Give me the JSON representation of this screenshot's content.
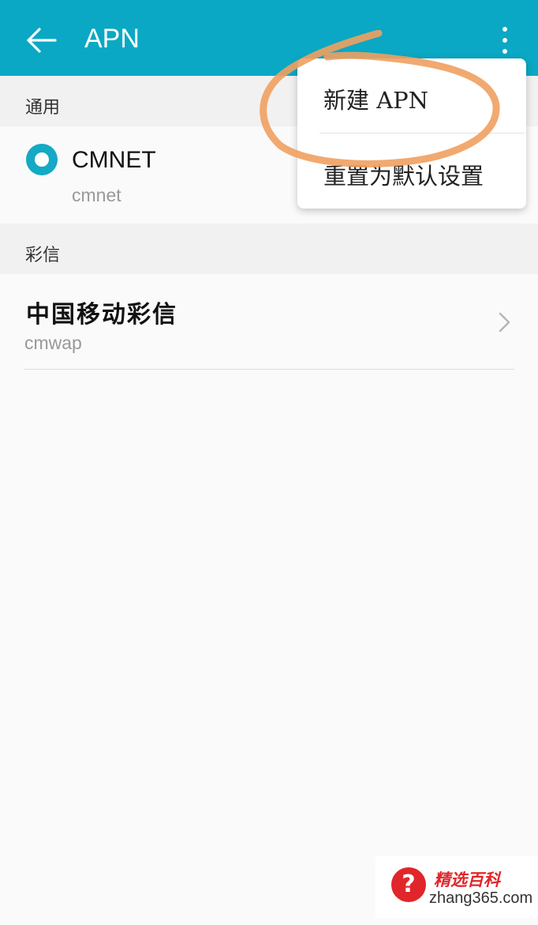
{
  "header": {
    "title": "APN",
    "back_icon": "arrow-left-icon",
    "overflow_icon": "more-vertical-icon",
    "color": "#0aa8c4"
  },
  "sections": {
    "general": {
      "label": "通用",
      "apn": {
        "name": "CMNET",
        "value": "cmnet",
        "selected": true
      }
    },
    "mms": {
      "label": "彩信",
      "apn": {
        "name": "中国移动彩信",
        "value": "cmwap"
      }
    }
  },
  "menu": {
    "items": [
      {
        "label": "新建 APN"
      },
      {
        "label": "重置为默认设置"
      }
    ]
  },
  "annotation": {
    "color": "#f0a060"
  },
  "watermark": {
    "brand": "精选百科",
    "domain": "zhang365.com",
    "symbol": "?",
    "color": "#e0262a"
  }
}
